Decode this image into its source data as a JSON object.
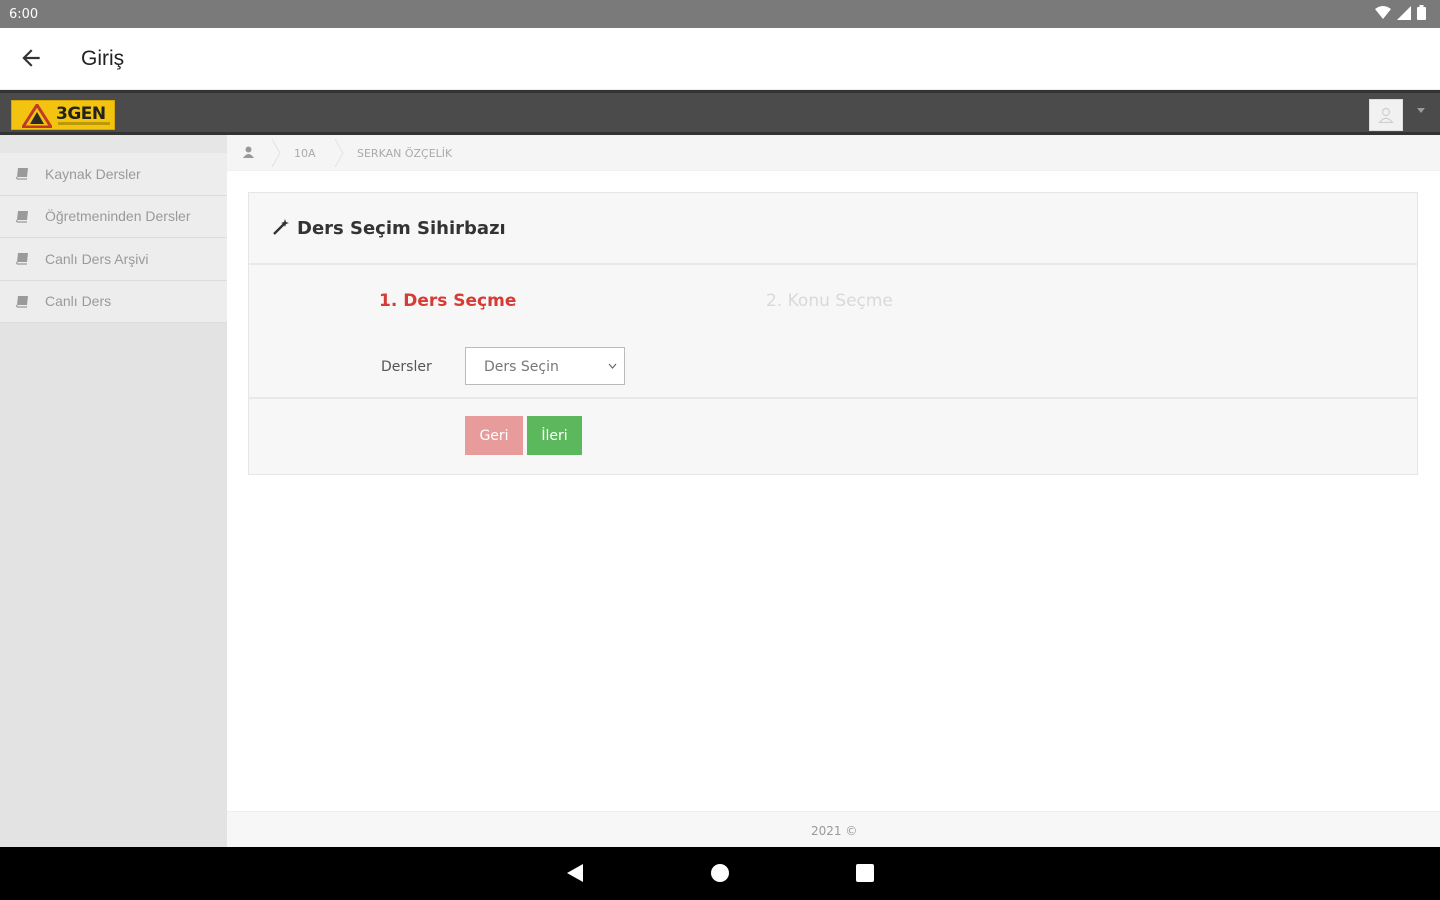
{
  "status_bar": {
    "time": "6:00"
  },
  "app_bar": {
    "title": "Giriş"
  },
  "logo": {
    "text": "3GEN"
  },
  "sidebar": {
    "items": [
      {
        "label": "Kaynak Dersler"
      },
      {
        "label": "Öğretmeninden Dersler"
      },
      {
        "label": "Canlı Ders Arşivi"
      },
      {
        "label": "Canlı Ders"
      }
    ]
  },
  "breadcrumb": {
    "class": "10A",
    "user": "SERKAN ÖZÇELİK"
  },
  "wizard": {
    "title": "Ders Seçim Sihirbazı",
    "step1": "1. Ders Seçme",
    "step2": "2. Konu Seçme",
    "field_label": "Dersler",
    "select_value": "Ders Seçin",
    "back_label": "Geri",
    "next_label": "İleri"
  },
  "footer": {
    "text": "2021 ©"
  },
  "colors": {
    "accent_red": "#d63b34",
    "button_back": "#e89b9b",
    "button_next": "#5cb85c",
    "logo_yellow": "#f2c40f",
    "navbar": "#4b4b4b"
  }
}
